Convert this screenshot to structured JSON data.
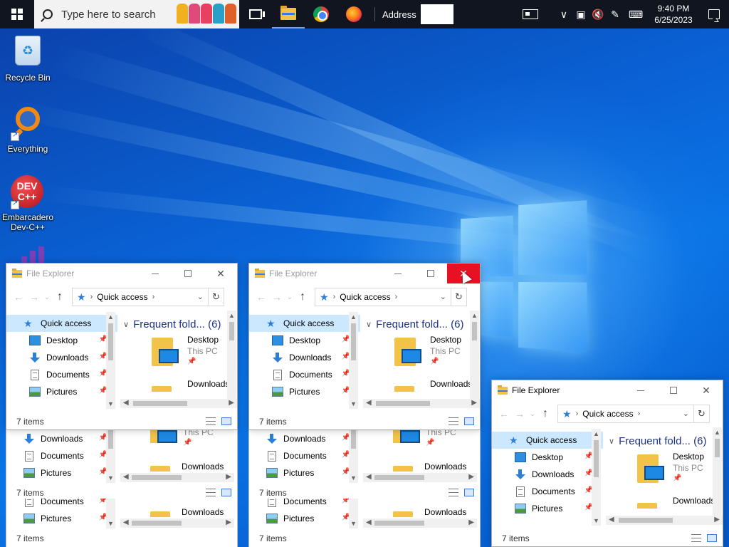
{
  "taskbar": {
    "search_placeholder": "Type here to search",
    "address_label": "Address",
    "time": "9:40 PM",
    "date": "6/25/2023"
  },
  "desktop": {
    "icons": [
      {
        "label": "Recycle Bin"
      },
      {
        "label": "Everything"
      },
      {
        "label": "Embarcadero Dev-C++"
      }
    ],
    "devcpp_logo_text": "DEV C++"
  },
  "explorer": {
    "title": "File Explorer",
    "location": "Quick access",
    "nav_items": [
      "Quick access",
      "Desktop",
      "Downloads",
      "Documents",
      "Pictures"
    ],
    "group_header": "Frequent fold... (6)",
    "tiles": [
      {
        "name": "Desktop",
        "sub": "This PC"
      },
      {
        "name": "Downloads"
      }
    ],
    "status": "7 items"
  },
  "stacked_fragments": {
    "frag1_nav": [
      "Downloads",
      "Documents",
      "Pictures"
    ],
    "frag1_tile_sub": "This PC",
    "frag1_tile_name2": "Downloads",
    "frag1_status": "7 items",
    "frag2_nav": [
      "Documents",
      "Pictures"
    ],
    "frag2_tile_name": "Downloads",
    "frag2_status": "7 items"
  },
  "colors": {
    "taskbar": "#101520",
    "selection": "#cce8ff",
    "close_hover": "#e81123",
    "group_header": "#1e3287",
    "accent": "#2c7fd4"
  },
  "icons": [
    "windows-start-icon",
    "search-icon",
    "task-view-icon",
    "file-explorer-icon",
    "chrome-icon",
    "firefox-icon",
    "news-icon",
    "notification-icon",
    "recycle-bin-icon",
    "everything-icon",
    "devcpp-icon"
  ]
}
